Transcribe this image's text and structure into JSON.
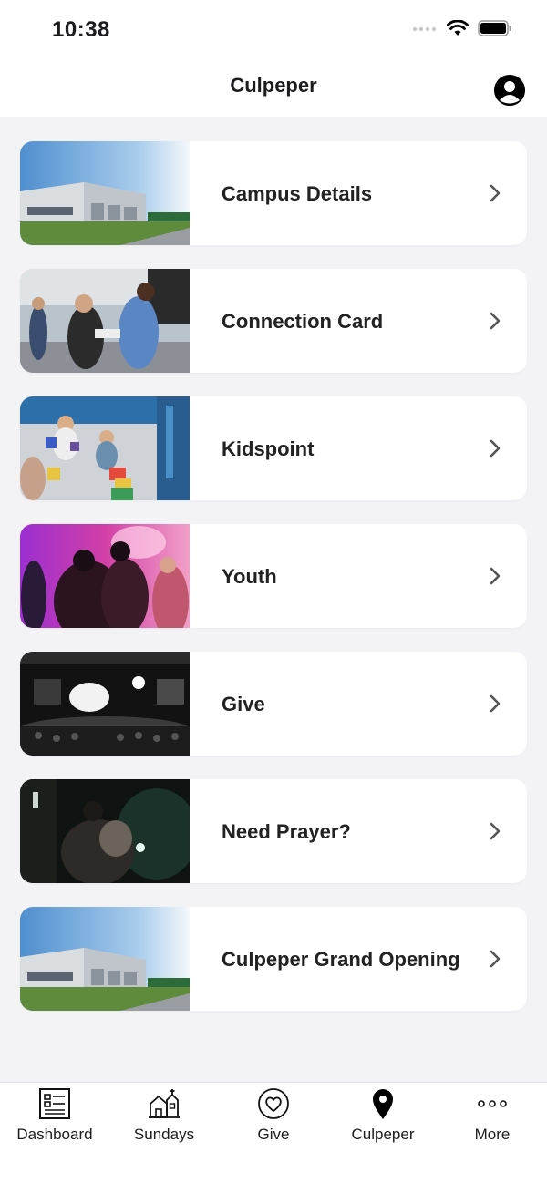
{
  "status_bar": {
    "time": "10:38"
  },
  "header": {
    "title": "Culpeper"
  },
  "cards": [
    {
      "label": "Campus Details",
      "image": "building-photo"
    },
    {
      "label": "Connection Card",
      "image": "greeting-photo"
    },
    {
      "label": "Kidspoint",
      "image": "kids-playroom-photo"
    },
    {
      "label": "Youth",
      "image": "youth-concert-photo"
    },
    {
      "label": "Give",
      "image": "stage-lights-photo"
    },
    {
      "label": "Need Prayer?",
      "image": "embrace-photo"
    },
    {
      "label": "Culpeper Grand Opening",
      "image": "building-photo"
    }
  ],
  "tabs": [
    {
      "label": "Dashboard",
      "icon": "dashboard-icon"
    },
    {
      "label": "Sundays",
      "icon": "church-icon"
    },
    {
      "label": "Give",
      "icon": "heart-icon"
    },
    {
      "label": "Culpeper",
      "icon": "map-pin-icon",
      "active": true
    },
    {
      "label": "More",
      "icon": "more-dots-icon"
    }
  ],
  "colors": {
    "background": "#f3f3f6",
    "card": "#ffffff",
    "text": "#1c1c1e",
    "chevron": "#555555"
  }
}
